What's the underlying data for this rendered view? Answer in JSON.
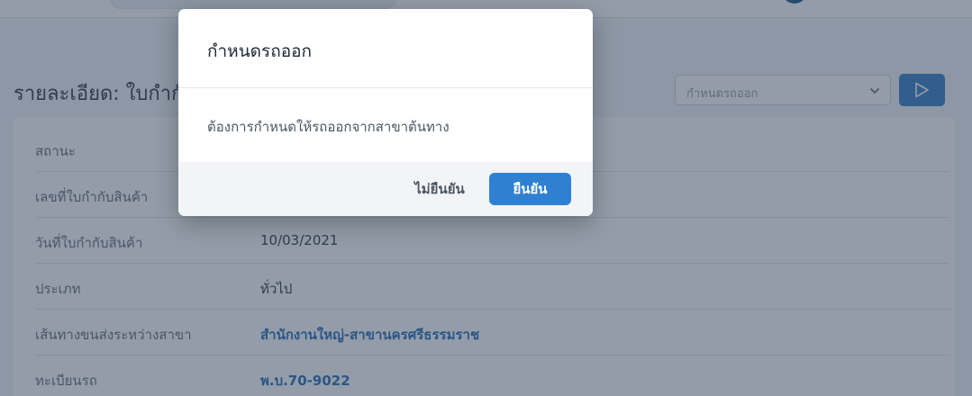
{
  "header": {
    "page_title": "รายละเอียด: ใบกำกับสินค้า"
  },
  "toolbar": {
    "action_select_value": "กำหนดรถออก",
    "run_icon": "play-icon",
    "chevron_icon": "chevron-down-icon"
  },
  "details": {
    "rows": [
      {
        "label": "สถานะ",
        "value": ""
      },
      {
        "label": "เลขที่ใบกำกับสินค้า",
        "value": ""
      },
      {
        "label": "วันที่ใบกำกับสินค้า",
        "value": "10/03/2021"
      },
      {
        "label": "ประเภท",
        "value": "ทั่วไป"
      },
      {
        "label": "เส้นทางขนส่งระหว่างสาขา",
        "value": "สำนักงานใหญ่-สาขานครศรีธรรมราช"
      },
      {
        "label": "ทะเบียนรถ",
        "value": "พ.บ.70-9022"
      }
    ]
  },
  "modal": {
    "title": "กำหนดรถออก",
    "message": "ต้องการกำหนดให้รถออกจากสาขาต้นทาง",
    "cancel_label": "ไม่ยืนยัน",
    "confirm_label": "ยืนยัน"
  },
  "colors": {
    "primary": "#2f80d1",
    "link": "#2f73b8",
    "overlay": "rgba(40,58,82,0.5)"
  }
}
